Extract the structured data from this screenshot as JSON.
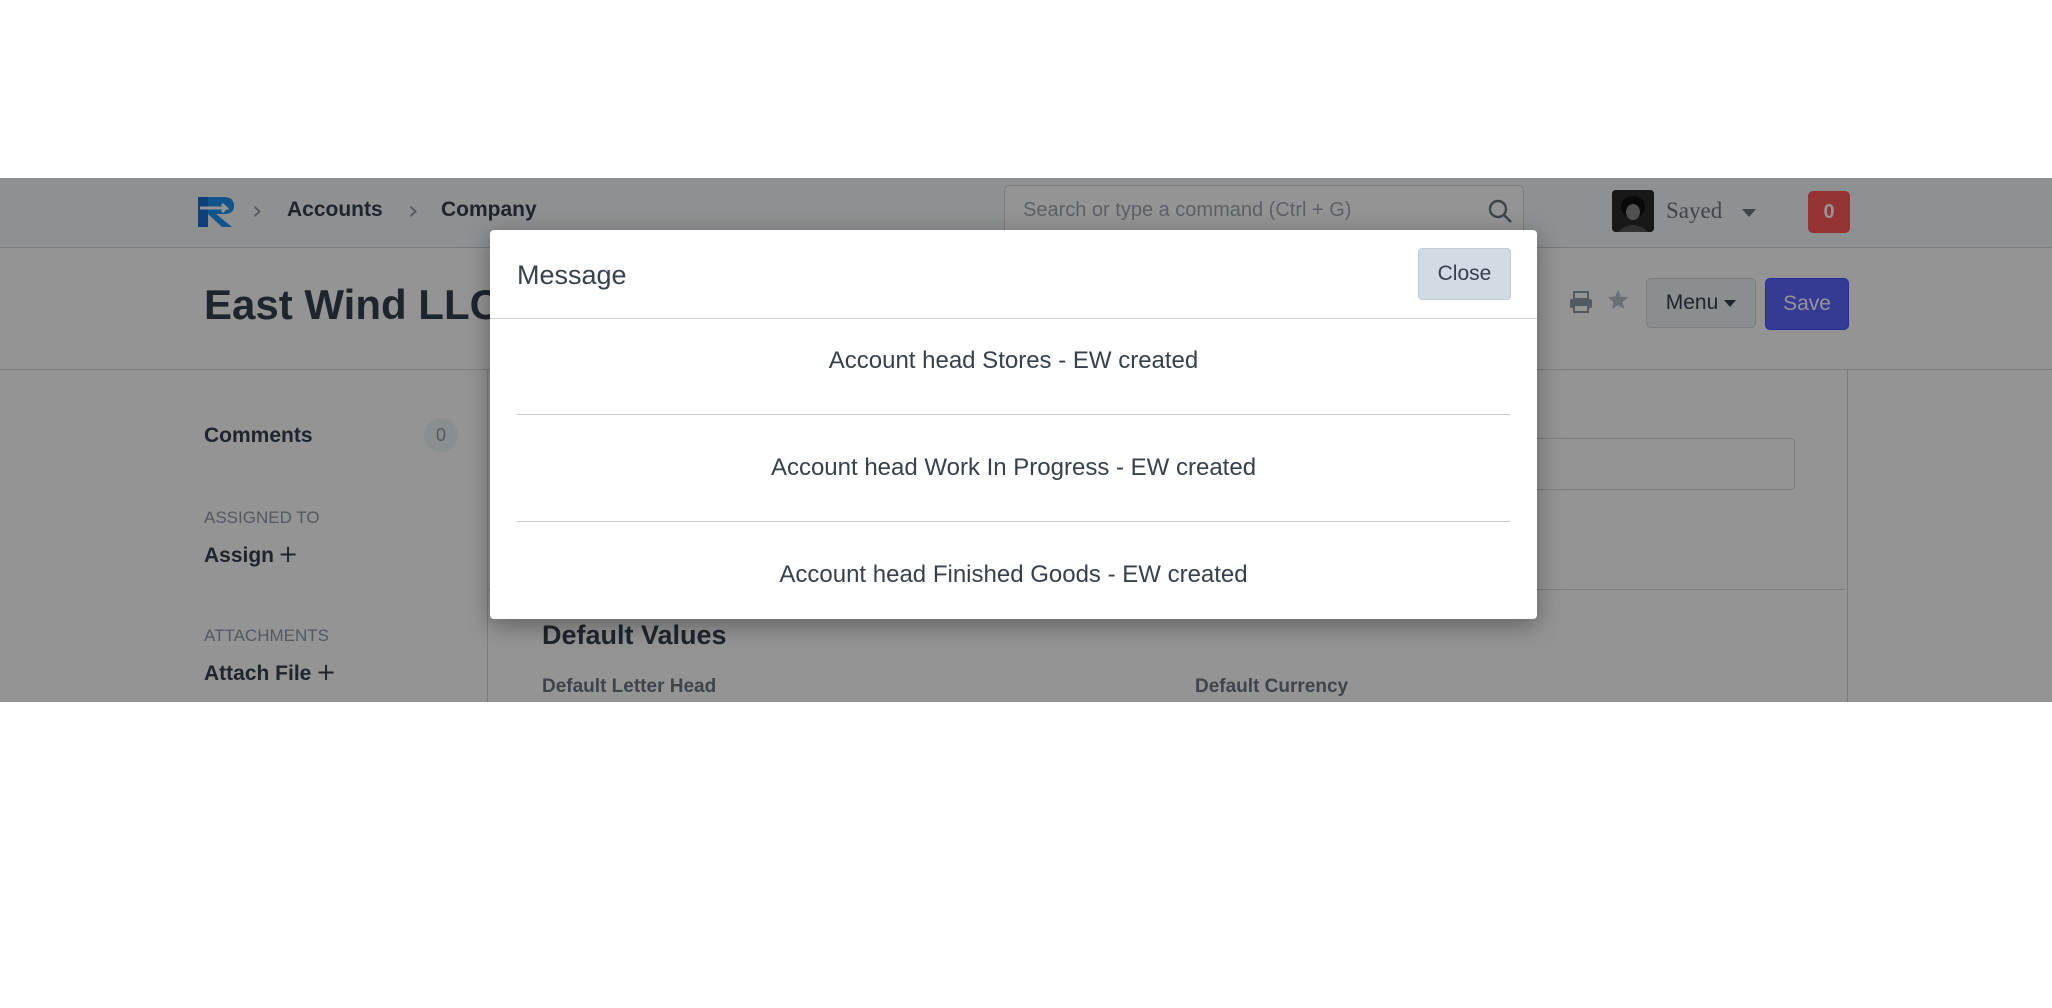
{
  "navbar": {
    "breadcrumbs": [
      "Accounts",
      "Company"
    ],
    "search": {
      "placeholder": "Search or type a command (Ctrl + G)"
    },
    "user": {
      "name": "Sayed"
    },
    "notifications": {
      "count": "0"
    }
  },
  "page": {
    "title": "East Wind LLC",
    "menu_label": "Menu",
    "save_label": "Save"
  },
  "sidebar": {
    "comments": {
      "label": "Comments",
      "count": "0"
    },
    "assigned_to": {
      "heading": "ASSIGNED TO",
      "action": "Assign"
    },
    "attachments": {
      "heading": "ATTACHMENTS",
      "action": "Attach File"
    }
  },
  "form": {
    "section_title": "Default Values",
    "fields": [
      "Default Letter Head",
      "Default Currency"
    ]
  },
  "modal": {
    "title": "Message",
    "close_label": "Close",
    "messages": [
      "Account head Stores - EW created",
      "Account head Work In Progress - EW created",
      "Account head Finished Goods - EW created"
    ]
  },
  "colors": {
    "primary": "#5e64ff",
    "danger": "#ff5858",
    "text": "#36414c",
    "border": "#d1d8dd"
  }
}
